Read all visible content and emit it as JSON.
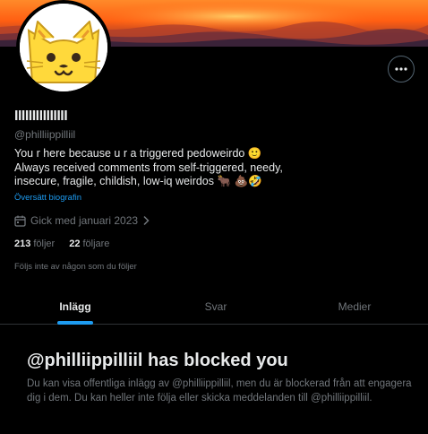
{
  "banner": {
    "description_icon": "sunset-banner"
  },
  "avatar": {
    "icon": "cat-face-emoji",
    "colors": {
      "face": "#ffd93b",
      "outline": "#b8860b"
    }
  },
  "profile": {
    "display_name": "IIIIIIIIIIIIIII",
    "handle": "@philliippilliil",
    "bio_lines": [
      "You r here because u r a triggered pedoweirdo 🙂",
      "Always received comments from self-triggered, needy,",
      "insecure, fragile, childish, low-iq weirdos 🐂 💩🤣"
    ],
    "translate_label": "Översätt biografin",
    "joined": "Gick med januari 2023",
    "following_count": "213",
    "following_label": "följer",
    "followers_count": "22",
    "followers_label": "följare",
    "followed_by": "Följs inte av någon som du följer"
  },
  "tabs": [
    {
      "label": "Inlägg",
      "active": true
    },
    {
      "label": "Svar",
      "active": false
    },
    {
      "label": "Medier",
      "active": false
    }
  ],
  "blocked": {
    "title": "@philliippilliil has blocked you",
    "description": "Du kan visa offentliga inlägg av @philliippilliil, men du är blockerad från att engagera dig i dem. Du kan heller inte följa eller skicka meddelanden till @philliippilliil."
  },
  "colors": {
    "background": "#000000",
    "primary_text": "#e7e9ea",
    "secondary_text": "#71767b",
    "accent": "#1d9bf0",
    "border": "#2f3336"
  }
}
